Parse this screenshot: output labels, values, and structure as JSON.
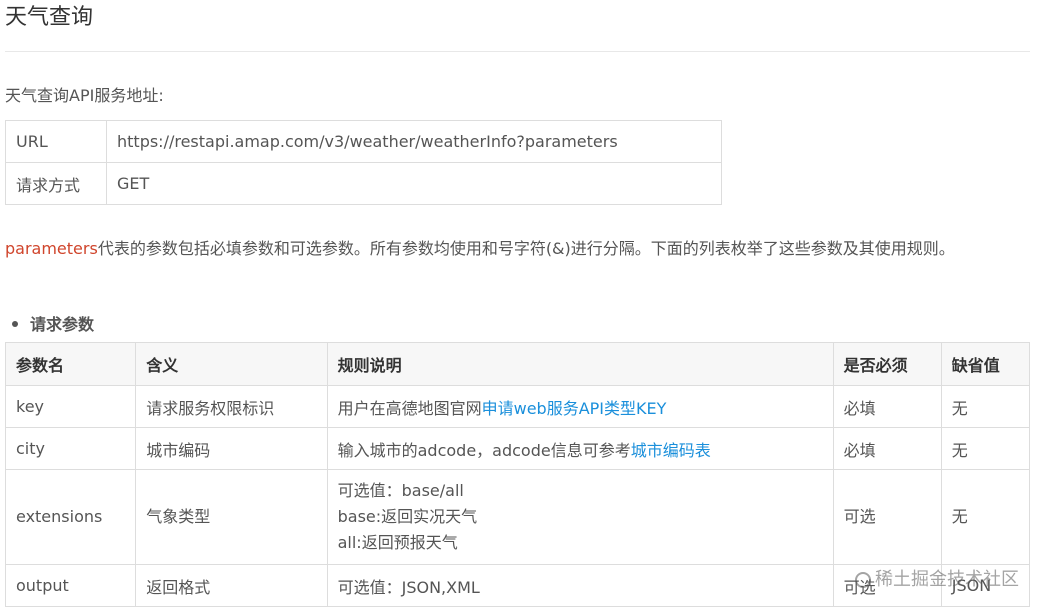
{
  "page": {
    "title": "天气查询"
  },
  "intro": "天气查询API服务地址:",
  "url_table": {
    "rows": [
      {
        "key": "URL",
        "value": "https://restapi.amap.com/v3/weather/weatherInfo?parameters"
      },
      {
        "key": "请求方式",
        "value": "GET"
      }
    ]
  },
  "description": {
    "highlight": "parameters",
    "text": "代表的参数包括必填参数和可选参数。所有参数均使用和号字符(&)进行分隔。下面的列表枚举了这些参数及其使用规则。"
  },
  "section": {
    "label": "请求参数"
  },
  "param_table": {
    "headers": [
      "参数名",
      "含义",
      "规则说明",
      "是否必须",
      "缺省值"
    ],
    "rows": [
      {
        "name": "key",
        "meaning": "请求服务权限标识",
        "rule_prefix": "用户在高德地图官网",
        "rule_link": "申请web服务API类型KEY",
        "required": "必填",
        "default": "无"
      },
      {
        "name": "city",
        "meaning": "城市编码",
        "rule_prefix": "输入城市的adcode，adcode信息可参考",
        "rule_link": "城市编码表",
        "required": "必填",
        "default": "无"
      },
      {
        "name": "extensions",
        "meaning": "气象类型",
        "rule_lines": [
          "可选值：base/all",
          "base:返回实况天气",
          "all:返回预报天气"
        ],
        "required": "可选",
        "default": "无"
      },
      {
        "name": "output",
        "meaning": "返回格式",
        "rule": "可选值：JSON,XML",
        "required": "可选",
        "default": "JSON"
      }
    ]
  },
  "watermark": {
    "text": "稀土掘金技术社区",
    "icon": "juejin-logo-icon"
  }
}
